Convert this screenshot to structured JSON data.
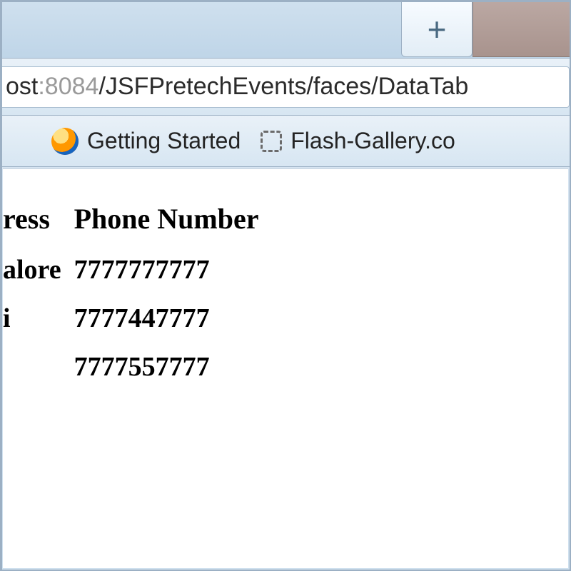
{
  "tabs": {
    "newtab_glyph": "+"
  },
  "url": {
    "pre": "ost",
    "dim": ":8084",
    "path": "/JSFPretechEvents/faces/DataTab"
  },
  "bookmarks": {
    "b1": "Getting Started",
    "b2": "Flash-Gallery.co"
  },
  "table": {
    "head_address": "ress",
    "head_phone": "Phone Number",
    "rows": [
      {
        "address": "alore",
        "phone": "7777777777"
      },
      {
        "address": "i",
        "phone": "7777447777"
      },
      {
        "address": "",
        "phone": "7777557777"
      }
    ]
  }
}
